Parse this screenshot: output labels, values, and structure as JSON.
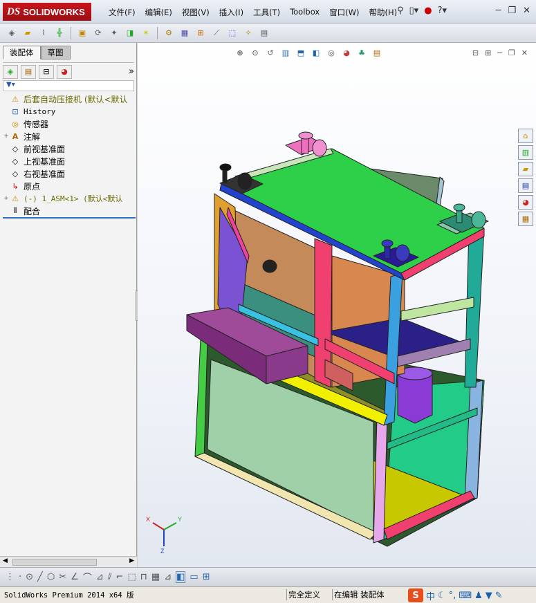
{
  "app": {
    "brand_ds": "DS",
    "brand_name": "SOLIDWORKS"
  },
  "menu": [
    "文件(F)",
    "编辑(E)",
    "视图(V)",
    "插入(I)",
    "工具(T)",
    "Toolbox",
    "窗口(W)",
    "帮助(H)"
  ],
  "panel": {
    "tabs": [
      "装配体",
      "草图"
    ],
    "tree": [
      {
        "label": "后套自动压接机  (默认<默认",
        "style": "olive",
        "expand": "",
        "icon": "assembly-warning"
      },
      {
        "label": "History",
        "style": "mono",
        "expand": "",
        "icon": "history"
      },
      {
        "label": "传感器",
        "style": "",
        "expand": "",
        "icon": "sensor"
      },
      {
        "label": "注解",
        "style": "",
        "expand": "+",
        "icon": "annotation"
      },
      {
        "label": "前视基准面",
        "style": "",
        "expand": "",
        "icon": "plane"
      },
      {
        "label": "上视基准面",
        "style": "",
        "expand": "",
        "icon": "plane"
      },
      {
        "label": "右视基准面",
        "style": "",
        "expand": "",
        "icon": "plane"
      },
      {
        "label": "原点",
        "style": "",
        "expand": "",
        "icon": "origin"
      },
      {
        "label": "(-) 1_ASM<1> (默认<默认",
        "style": "olive",
        "expand": "+",
        "icon": "assembly-warning"
      },
      {
        "label": "配合",
        "style": "",
        "expand": "",
        "icon": "mates"
      }
    ]
  },
  "triad": {
    "x": "X",
    "y": "Y",
    "z": "Z"
  },
  "status": {
    "product": "SolidWorks Premium 2014 x64 版",
    "state": "完全定义",
    "mode": "在编辑 装配体",
    "ime": "中"
  },
  "colors": {
    "accent": "#2f6fc0",
    "brand": "#c8161d"
  }
}
